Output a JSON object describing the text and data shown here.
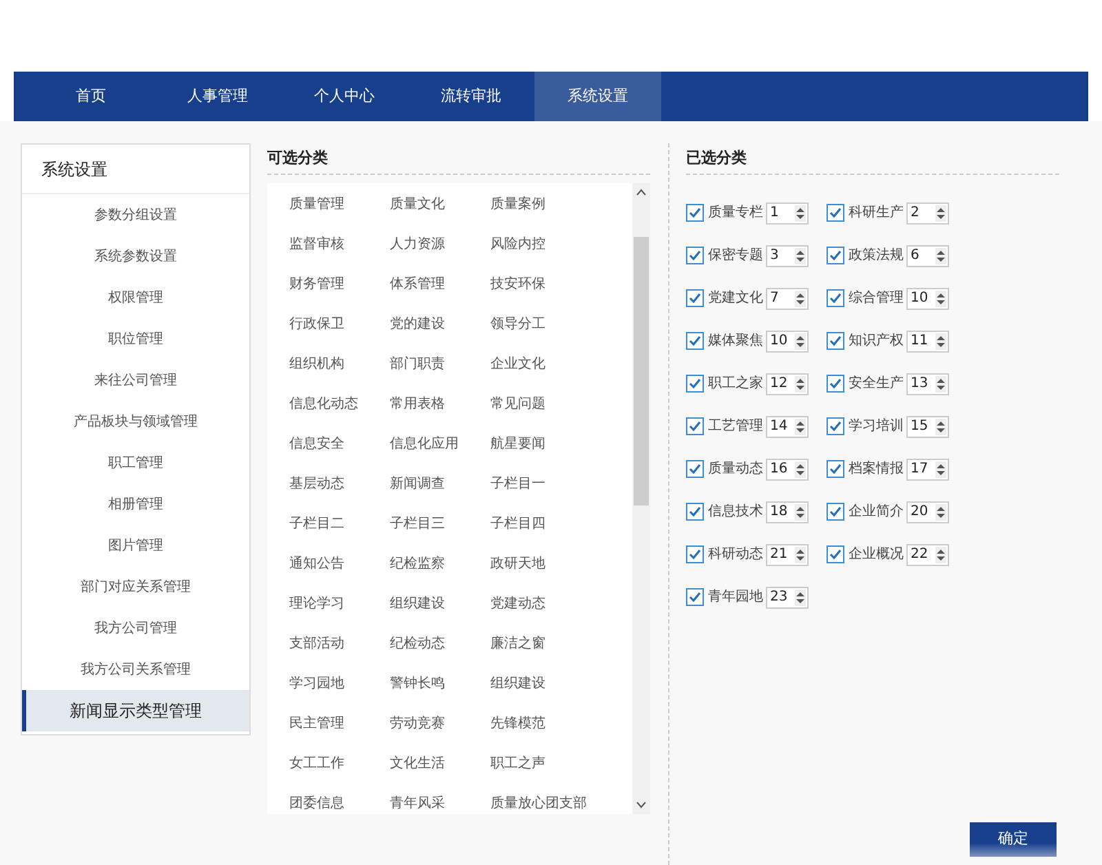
{
  "nav": [
    {
      "label": "首页",
      "selected": false
    },
    {
      "label": "人事管理",
      "selected": false
    },
    {
      "label": "个人中心",
      "selected": false
    },
    {
      "label": "流转审批",
      "selected": false
    },
    {
      "label": "系统设置",
      "selected": true
    }
  ],
  "sidebar": {
    "title": "系统设置",
    "items": [
      {
        "label": "参数分组设置",
        "selected": false
      },
      {
        "label": "系统参数设置",
        "selected": false
      },
      {
        "label": "权限管理",
        "selected": false
      },
      {
        "label": "职位管理",
        "selected": false
      },
      {
        "label": "来往公司管理",
        "selected": false
      },
      {
        "label": "产品板块与领域管理",
        "selected": false
      },
      {
        "label": "职工管理",
        "selected": false
      },
      {
        "label": "相册管理",
        "selected": false
      },
      {
        "label": "图片管理",
        "selected": false
      },
      {
        "label": "部门对应关系管理",
        "selected": false
      },
      {
        "label": "我方公司管理",
        "selected": false
      },
      {
        "label": "我方公司关系管理",
        "selected": false
      },
      {
        "label": "新闻显示类型管理",
        "selected": true
      }
    ]
  },
  "available": {
    "title": "可选分类",
    "items": [
      "质量管理",
      "质量文化",
      "质量案例",
      "监督审核",
      "人力资源",
      "风险内控",
      "财务管理",
      "体系管理",
      "技安环保",
      "行政保卫",
      "党的建设",
      "领导分工",
      "组织机构",
      "部门职责",
      "企业文化",
      "信息化动态",
      "常用表格",
      "常见问题",
      "信息安全",
      "信息化应用",
      "航星要闻",
      "基层动态",
      "新闻调查",
      "子栏目一",
      "子栏目二",
      "子栏目三",
      "子栏目四",
      "通知公告",
      "纪检监察",
      "政研天地",
      "理论学习",
      "组织建设",
      "党建动态",
      "支部活动",
      "纪检动态",
      "廉洁之窗",
      "学习园地",
      "警钟长鸣",
      "组织建设",
      "民主管理",
      "劳动竞赛",
      "先锋模范",
      "女工工作",
      "文化生活",
      "职工之声",
      "团委信息",
      "青年风采",
      "质量放心团支部"
    ]
  },
  "chosen": {
    "title": "已选分类",
    "items": [
      {
        "label": "质量专栏",
        "checked": true,
        "order": "1"
      },
      {
        "label": "科研生产",
        "checked": true,
        "order": "2"
      },
      {
        "label": "保密专题",
        "checked": true,
        "order": "3"
      },
      {
        "label": "政策法规",
        "checked": true,
        "order": "6"
      },
      {
        "label": "党建文化",
        "checked": true,
        "order": "7"
      },
      {
        "label": "综合管理",
        "checked": true,
        "order": "10"
      },
      {
        "label": "媒体聚焦",
        "checked": true,
        "order": "10"
      },
      {
        "label": "知识产权",
        "checked": true,
        "order": "11"
      },
      {
        "label": "职工之家",
        "checked": true,
        "order": "12"
      },
      {
        "label": "安全生产",
        "checked": true,
        "order": "13"
      },
      {
        "label": "工艺管理",
        "checked": true,
        "order": "14"
      },
      {
        "label": "学习培训",
        "checked": true,
        "order": "15"
      },
      {
        "label": "质量动态",
        "checked": true,
        "order": "16"
      },
      {
        "label": "档案情报",
        "checked": true,
        "order": "17"
      },
      {
        "label": "信息技术",
        "checked": true,
        "order": "18"
      },
      {
        "label": "企业简介",
        "checked": true,
        "order": "20"
      },
      {
        "label": "科研动态",
        "checked": true,
        "order": "21"
      },
      {
        "label": "企业概况",
        "checked": true,
        "order": "22"
      },
      {
        "label": "青年园地",
        "checked": true,
        "order": "23"
      }
    ]
  },
  "confirm_button": "确定"
}
